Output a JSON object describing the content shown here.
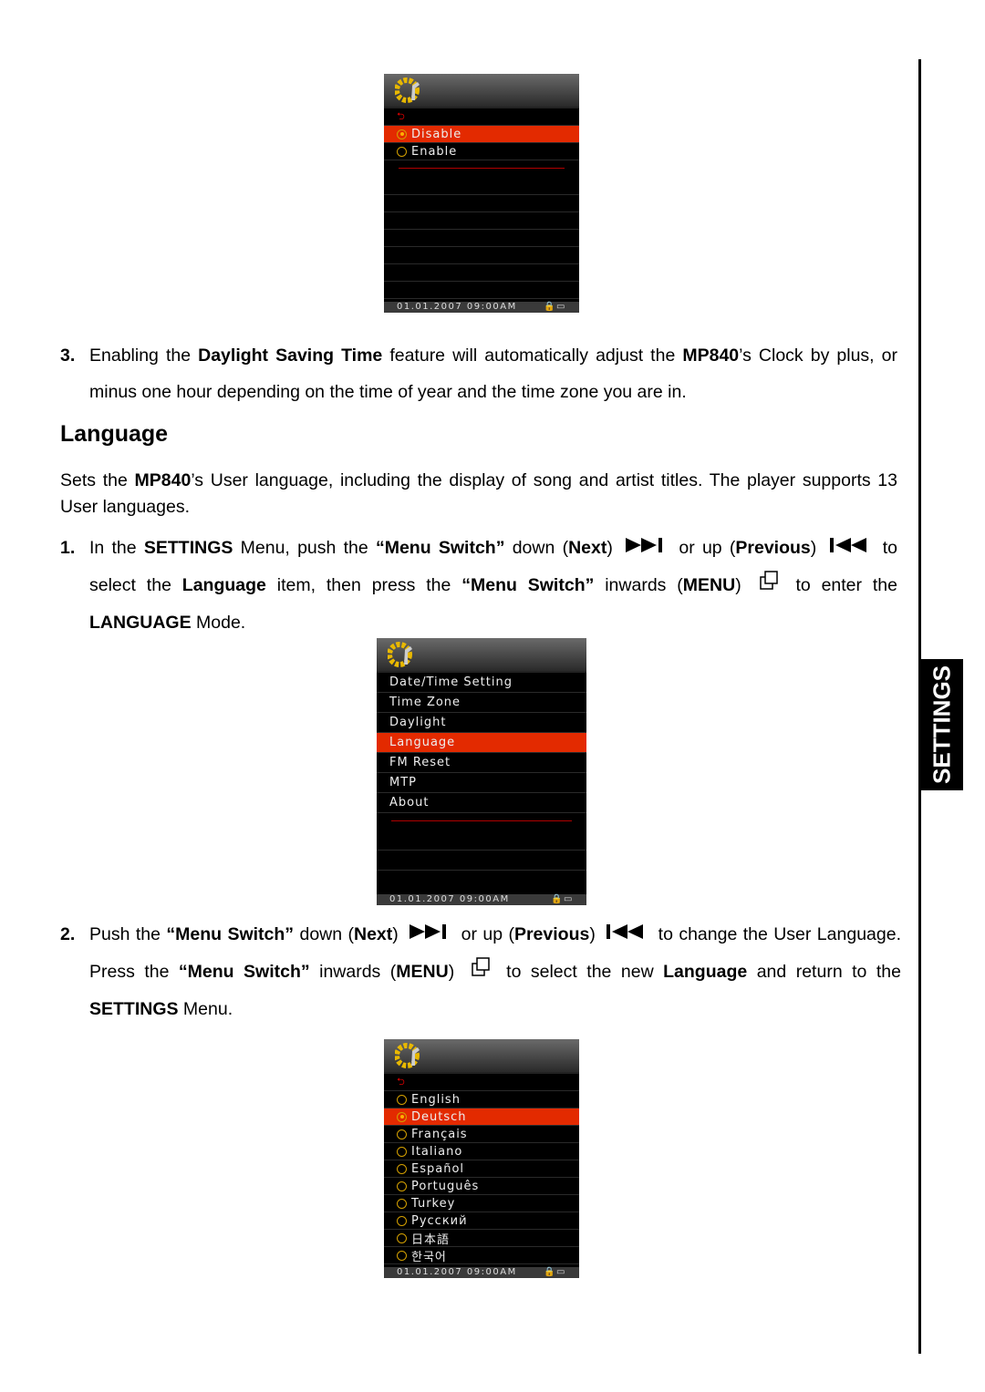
{
  "colors": {
    "highlight": "#e32a00",
    "radio": "#d4a000"
  },
  "side_tab": "SETTINGS",
  "screen1": {
    "back_icon": "return-arrow-icon",
    "items": [
      {
        "label": "Disable",
        "selected": true
      },
      {
        "label": "Enable",
        "selected": false
      }
    ],
    "footer": "01.01.2007  09:00AM"
  },
  "item3": {
    "num": "3.",
    "parts": [
      [
        "Enabling the ",
        0
      ],
      [
        "Daylight Saving Time",
        1
      ],
      [
        " feature will automatically adjust the ",
        0
      ],
      [
        "MP840",
        1
      ],
      [
        "’s Clock by plus, or minus one hour depending on the time of year and the time zone you are in.",
        0
      ]
    ]
  },
  "heading": "Language",
  "intro": {
    "parts": [
      [
        "Sets the ",
        0
      ],
      [
        "MP840",
        1
      ],
      [
        "’s User language, including the display of song and artist titles. The player supports 13 User languages.",
        0
      ]
    ]
  },
  "step1": {
    "num": "1.",
    "parts": [
      [
        "In the ",
        0
      ],
      [
        "SETTINGS",
        1
      ],
      [
        " Menu, push the ",
        0
      ],
      [
        "“Menu Switch”",
        1
      ],
      [
        " down (",
        0
      ],
      [
        "Next",
        1
      ],
      [
        ") ",
        0
      ],
      [
        "#next",
        0
      ],
      [
        " or up (",
        0
      ],
      [
        "Previous",
        1
      ],
      [
        ") ",
        0
      ],
      [
        "#prev",
        0
      ],
      [
        " to select the ",
        0
      ],
      [
        "Language",
        1
      ],
      [
        " item, then press the ",
        0
      ],
      [
        "“Menu Switch”",
        1
      ],
      [
        " inwards (",
        0
      ],
      [
        "MENU",
        1
      ],
      [
        ") ",
        0
      ],
      [
        "#menu",
        0
      ],
      [
        " to enter the ",
        0
      ],
      [
        "LANGUAGE",
        1
      ],
      [
        " Mode.",
        0
      ]
    ]
  },
  "screen2": {
    "items": [
      {
        "label": "Date/Time Setting"
      },
      {
        "label": "Time Zone"
      },
      {
        "label": "Daylight"
      },
      {
        "label": "Language",
        "selected": true
      },
      {
        "label": "FM Reset"
      },
      {
        "label": "MTP"
      },
      {
        "label": "About"
      }
    ],
    "footer": "01.01.2007  09:00AM"
  },
  "step2": {
    "num": "2.",
    "parts": [
      [
        "Push the ",
        0
      ],
      [
        "“Menu Switch”",
        1
      ],
      [
        " down (",
        0
      ],
      [
        "Next",
        1
      ],
      [
        ") ",
        0
      ],
      [
        "#next",
        0
      ],
      [
        " or up (",
        0
      ],
      [
        "Previous",
        1
      ],
      [
        ") ",
        0
      ],
      [
        "#prev",
        0
      ],
      [
        " to change the User Language. Press the ",
        0
      ],
      [
        "“Menu Switch”",
        1
      ],
      [
        " inwards (",
        0
      ],
      [
        "MENU",
        1
      ],
      [
        ") ",
        0
      ],
      [
        "#menu",
        0
      ],
      [
        " to select the new ",
        0
      ],
      [
        "Language",
        1
      ],
      [
        " and return to the ",
        0
      ],
      [
        "SETTINGS",
        1
      ],
      [
        " Menu.",
        0
      ]
    ]
  },
  "screen3": {
    "items": [
      {
        "label": "English"
      },
      {
        "label": "Deutsch",
        "selected": true
      },
      {
        "label": "Français"
      },
      {
        "label": "Italiano"
      },
      {
        "label": "Español"
      },
      {
        "label": "Português"
      },
      {
        "label": "Turkey"
      },
      {
        "label": "Русский"
      },
      {
        "label": "日本語"
      },
      {
        "label": "한국어"
      }
    ],
    "footer": "01.01.2007  09:00AM"
  }
}
